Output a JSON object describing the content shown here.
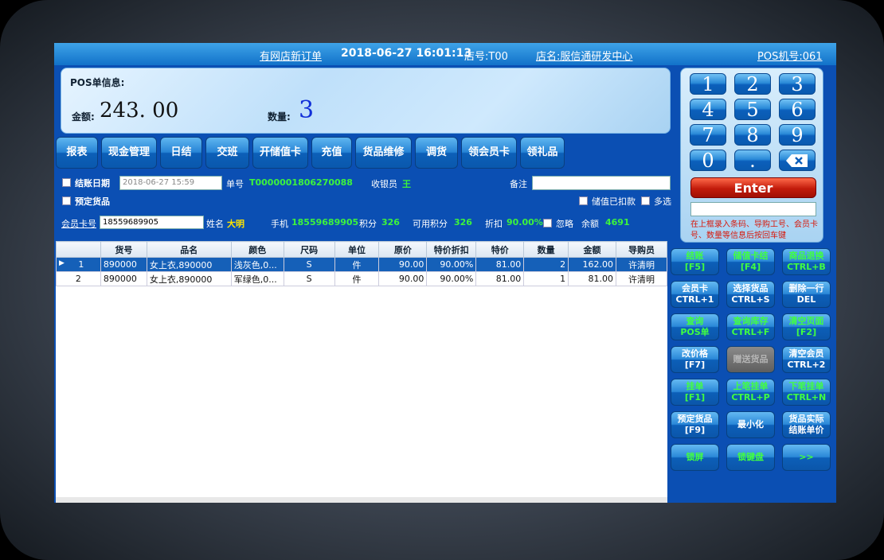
{
  "title": {
    "new_order": "有网店新订单",
    "datetime": "2018-06-27 16:01:13",
    "store_no": "店号:T00",
    "store_name": "店名:服信通研发中心",
    "pos_no": "POS机号:061"
  },
  "pos_info": {
    "heading": "POS单信息:",
    "amount_label": "金额:",
    "amount": "243. 00",
    "qty_label": "数量:",
    "qty": "3"
  },
  "function_buttons": [
    "报表",
    "现金管理",
    "日结",
    "交班",
    "开储值卡",
    "充值",
    "货品维修",
    "调货",
    "领会员卡",
    "领礼品"
  ],
  "form": {
    "settle_date_label": "结账日期",
    "settle_date_value": "2018-06-27 15:59",
    "order_label": "单号",
    "order_no": "T0000001806270088",
    "cashier_label": "收银员",
    "cashier": "王",
    "remark_label": "备注",
    "reserve_label": "预定货品",
    "stored_deducted_label": "储值已扣款",
    "multi_select_label": "多选",
    "member_card_label": "会员卡号",
    "member_card_value": "18559689905",
    "name_label": "姓名",
    "name": "大明",
    "phone_label": "手机",
    "phone": "18559689905",
    "points_label": "积分",
    "points": "326",
    "avail_points_label": "可用积分",
    "avail_points": "326",
    "discount_label": "折扣",
    "discount": "90.00%",
    "ignore_label": "忽略",
    "balance_label": "余额",
    "balance": "4691"
  },
  "table": {
    "headers": [
      "",
      "货号",
      "品名",
      "颜色",
      "尺码",
      "单位",
      "原价",
      "特价折扣",
      "特价",
      "数量",
      "金额",
      "导购员"
    ],
    "rows": [
      [
        "1",
        "890000",
        "女上衣,890000",
        "浅灰色,0...",
        "S",
        "件",
        "90.00",
        "90.00%",
        "81.00",
        "2",
        "162.00",
        "许清明"
      ],
      [
        "2",
        "890000",
        "女上衣,890000",
        "军绿色,0...",
        "S",
        "件",
        "90.00",
        "90.00%",
        "81.00",
        "1",
        "81.00",
        "许清明"
      ]
    ]
  },
  "keypad": {
    "keys": [
      "1",
      "2",
      "3",
      "4",
      "5",
      "6",
      "7",
      "8",
      "9",
      "0",
      "."
    ],
    "enter": "Enter",
    "hint": "在上框录入条码、导购工号、会员卡号、数量等信息后按回车键"
  },
  "side_buttons": [
    {
      "l1": "结账",
      "l2": "[F5]",
      "style": "g"
    },
    {
      "l1": "储值卡结",
      "l2": "[F4]",
      "style": "g"
    },
    {
      "l1": "商品退换",
      "l2": "CTRL+B",
      "style": "g"
    },
    {
      "l1": "会员卡",
      "l2": "CTRL+1",
      "style": "w"
    },
    {
      "l1": "选择货品",
      "l2": "CTRL+S",
      "style": "w"
    },
    {
      "l1": "删除一行",
      "l2": "DEL",
      "style": "w"
    },
    {
      "l1": "查询",
      "l2": "POS单",
      "style": "g"
    },
    {
      "l1": "查询库存",
      "l2": "CTRL+F",
      "style": "g"
    },
    {
      "l1": "清空页面",
      "l2": "[F2]",
      "style": "g"
    },
    {
      "l1": "改价格",
      "l2": "[F7]",
      "style": "w"
    },
    {
      "l1": "赠送货品",
      "l2": "",
      "style": "dis"
    },
    {
      "l1": "清空会员",
      "l2": "CTRL+2",
      "style": "w"
    },
    {
      "l1": "挂单",
      "l2": "[F1]",
      "style": "g"
    },
    {
      "l1": "上笔挂单",
      "l2": "CTRL+P",
      "style": "g"
    },
    {
      "l1": "下笔挂单",
      "l2": "CTRL+N",
      "style": "g"
    },
    {
      "l1": "预定货品",
      "l2": "[F9]",
      "style": "w"
    },
    {
      "l1": "最小化",
      "l2": "",
      "style": "w"
    },
    {
      "l1": "货品实际",
      "l2": "结账单价",
      "style": "w"
    },
    {
      "l1": "锁屏",
      "l2": "",
      "style": "g"
    },
    {
      "l1": "锁键盘",
      "l2": "",
      "style": "g"
    },
    {
      "l1": ">>",
      "l2": "",
      "style": "g"
    }
  ]
}
